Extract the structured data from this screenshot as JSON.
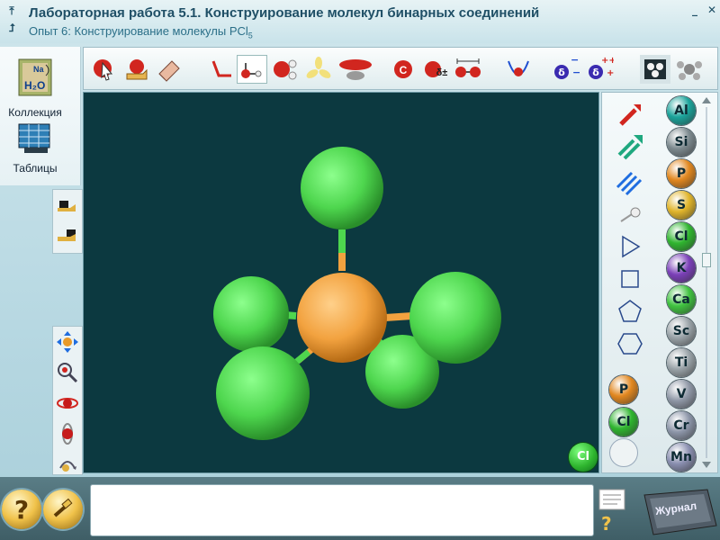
{
  "window": {
    "title": "Лабораторная работа 5.1. Конструирование молекул бинарных соединений",
    "subtitle_prefix": "Опыт 6: Конструирование молекулы PCl",
    "subtitle_sub": "5"
  },
  "left_panel": {
    "collection_label": "Коллекция",
    "tables_label": "Таблицы",
    "collection_badge": "H₂O",
    "collection_na": "Na"
  },
  "toolbar": {
    "icons": [
      "select-pointer-icon",
      "hand-drag-icon",
      "eraser-icon",
      "bond-angle-icon",
      "molecule-model-icon",
      "ball-stick-icon",
      "orbital-hybrid-icon",
      "orbital-p-icon",
      "atom-c-icon",
      "partial-charge-icon",
      "bond-length-icon",
      "potential-well-icon",
      "dipole-negative-icon",
      "dipole-positive-icon",
      "camera-molecule-icon",
      "rotate-model-icon"
    ],
    "charge_label": "δ±",
    "c_label": "C"
  },
  "palette": {
    "left_elements": [
      {
        "symbol": "P",
        "color": "#e1871f"
      },
      {
        "symbol": "Cl",
        "color": "#2fb52f"
      }
    ],
    "right_elements": [
      {
        "symbol": "Al",
        "color": "#1aa39a"
      },
      {
        "symbol": "Si",
        "color": "#7d8a8f"
      },
      {
        "symbol": "P",
        "color": "#e1871f"
      },
      {
        "symbol": "S",
        "color": "#e0b42a"
      },
      {
        "symbol": "Cl",
        "color": "#2fb52f"
      },
      {
        "symbol": "K",
        "color": "#7b40b8"
      },
      {
        "symbol": "Ca",
        "color": "#3fc23f"
      },
      {
        "symbol": "Sc",
        "color": "#9aa3a8"
      },
      {
        "symbol": "Ti",
        "color": "#9aa3a8"
      },
      {
        "symbol": "V",
        "color": "#8f97a6"
      },
      {
        "symbol": "Cr",
        "color": "#8c95a8"
      },
      {
        "symbol": "Mn",
        "color": "#8a8fb0"
      }
    ]
  },
  "canvas": {
    "active_element": "Cl",
    "molecule": "PCl5",
    "central_atom": {
      "symbol": "P",
      "color": "#f2a23f"
    },
    "ligand_color": "#5fe25f"
  },
  "bottom": {
    "help_symbol": "?",
    "journal_label": "Журнал",
    "note_question": "?"
  }
}
